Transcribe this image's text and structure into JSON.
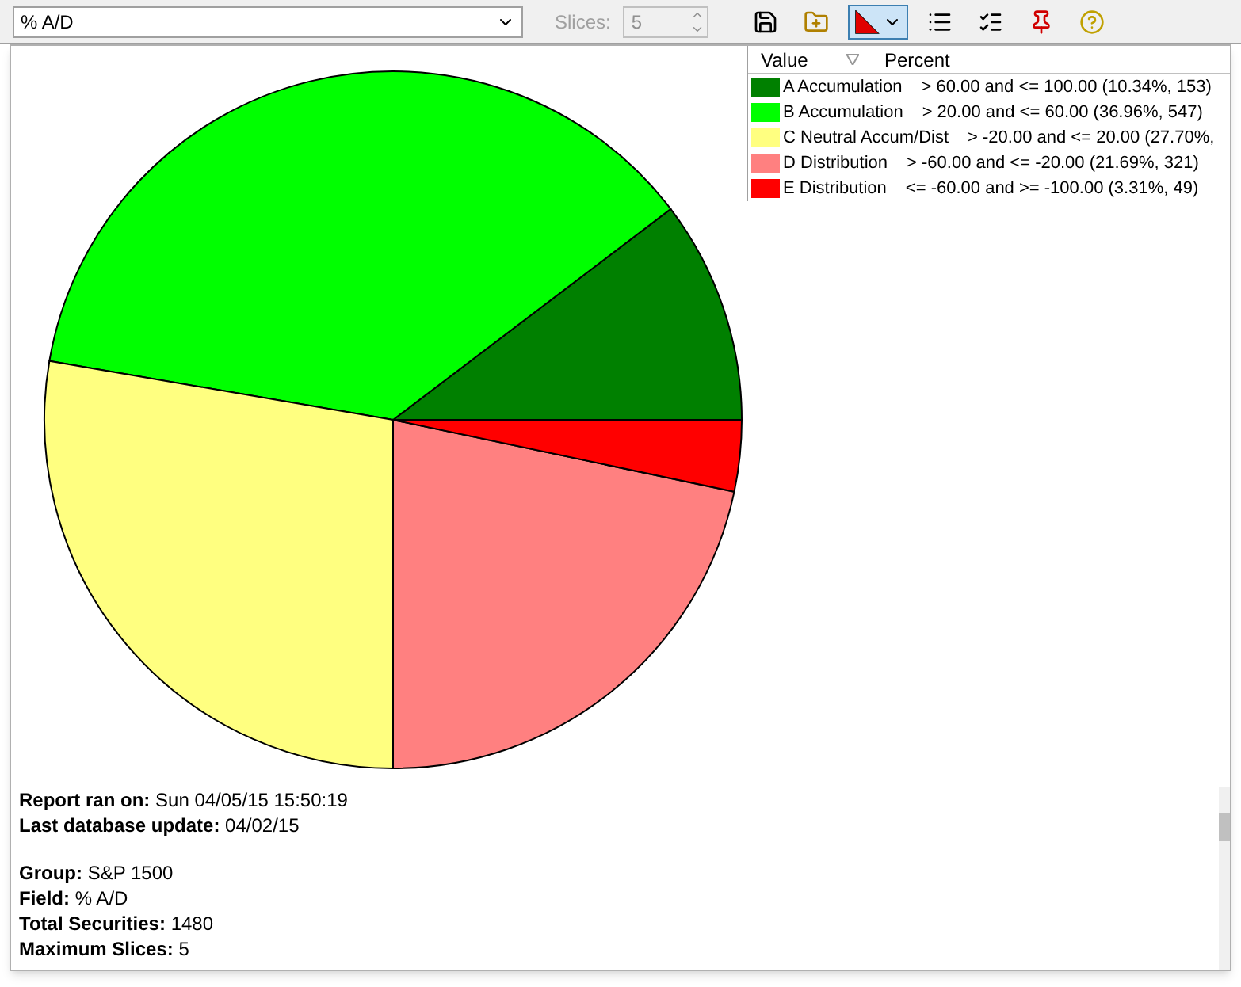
{
  "toolbar": {
    "field_select": {
      "value": "% A/D"
    },
    "slices": {
      "label": "Slices:",
      "value": "5",
      "disabled": true
    },
    "buttons": [
      {
        "kind": "save",
        "pressed": false
      },
      {
        "kind": "open",
        "pressed": false
      },
      {
        "kind": "pie",
        "pressed": true
      },
      {
        "kind": "list",
        "pressed": false
      },
      {
        "kind": "details",
        "pressed": false
      },
      {
        "kind": "pin",
        "pressed": false
      },
      {
        "kind": "help",
        "pressed": false
      }
    ]
  },
  "legend": {
    "columns": [
      "Value",
      "Percent"
    ],
    "items": [
      {
        "range": "> 60.00 and <= 100.00 (10.34%, 153)",
        "color": "#008000"
      },
      {
        "range": "> 20.00 and <= 60.00 (36.96%, 547)",
        "color": "#00ff00"
      },
      {
        "range": "> -20.00 and <= 20.00 (27.70%,",
        "color": "#ffff80"
      },
      {
        "range": "> -60.00 and <= -20.00 (21.69%, 321)",
        "color": "#ff8080"
      },
      {
        "range": "<= -60.00 and >= -100.00 (3.31%, 49)",
        "color": "#ff0000"
      }
    ]
  },
  "chart_data": {
    "type": "pie",
    "categories": [
      "A Accumulation",
      "B Accumulation",
      "C Neutral Accum/Dist",
      "D Distribution",
      "E Distribution"
    ],
    "values": [
      10.34,
      36.96,
      27.7,
      21.69,
      3.31
    ]
  },
  "report": [
    [
      {
        "label": "Report ran on:",
        "value": "Sun 04/05/15 15:50:19"
      },
      {
        "label": "Last database update:",
        "value": "04/02/15"
      }
    ],
    [
      {
        "label": "Group:",
        "value": "S&P 1500"
      },
      {
        "label": "Field:",
        "value": "% A/D"
      },
      {
        "label": "Total Securities:",
        "value": "1480"
      },
      {
        "label": "Maximum Slices:",
        "value": "5"
      }
    ]
  ]
}
